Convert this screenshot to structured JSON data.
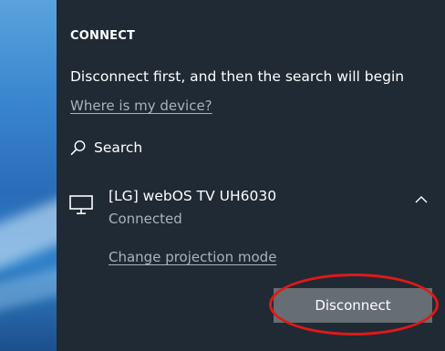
{
  "panel": {
    "heading": "CONNECT",
    "message": "Disconnect first, and then the search will begin",
    "where_link": "Where is my device?",
    "search_label": "Search"
  },
  "device": {
    "name": "[LG] webOS TV UH6030",
    "status": "Connected",
    "icon": "monitor-icon",
    "change_projection_link": "Change projection mode",
    "disconnect_label": "Disconnect"
  },
  "colors": {
    "panel_bg": "#1f2a35",
    "secondary_text": "#a8b3bd",
    "button_bg": "#666d73",
    "highlight": "#e11818"
  }
}
